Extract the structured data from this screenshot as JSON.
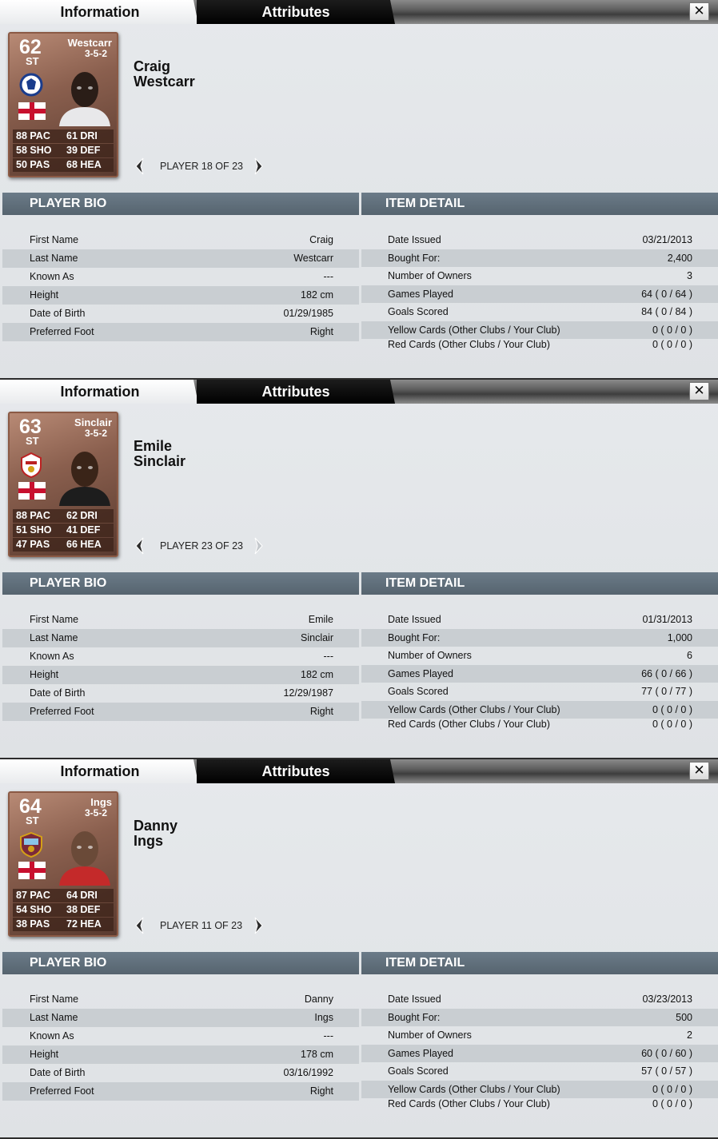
{
  "tabs": {
    "info": "Information",
    "attributes": "Attributes",
    "close": "✕"
  },
  "sections": {
    "bio": "PLAYER BIO",
    "item": "ITEM DETAIL"
  },
  "bio_labels": [
    "First Name",
    "Last Name",
    "Known As",
    "Height",
    "Date of Birth",
    "Preferred Foot"
  ],
  "item_labels": [
    "Date Issued",
    "Bought For:",
    "Number of Owners",
    "Games Played",
    "Goals Scored",
    "Yellow Cards (Other Clubs / Your Club)",
    "Red Cards (Other Clubs / Your Club)"
  ],
  "panels": [
    {
      "card": {
        "overall": "62",
        "position": "ST",
        "name": "Westcarr",
        "formation": "3-5-2",
        "stats": [
          [
            "88 PAC",
            "61 DRI"
          ],
          [
            "58 SHO",
            "39 DEF"
          ],
          [
            "50 PAS",
            "68 HEA"
          ]
        ],
        "club_icon": "chesterfield-badge-icon",
        "nation_icon": "england-flag-icon",
        "photo": "player-photo"
      },
      "first_name": "Craig",
      "last_name": "Westcarr",
      "pager": "PLAYER 18 OF 23",
      "next_enabled": true,
      "bio": [
        "Craig",
        "Westcarr",
        "---",
        "182 cm",
        "01/29/1985",
        "Right"
      ],
      "item": [
        "03/21/2013",
        "2,400",
        "3",
        "64 ( 0 / 64 )",
        "84 ( 0 / 84 )",
        "0 ( 0 / 0 )",
        "0 ( 0 / 0 )"
      ]
    },
    {
      "card": {
        "overall": "63",
        "position": "ST",
        "name": "Sinclair",
        "formation": "3-5-2",
        "stats": [
          [
            "88 PAC",
            "62 DRI"
          ],
          [
            "51 SHO",
            "41 DEF"
          ],
          [
            "47 PAS",
            "66 HEA"
          ]
        ],
        "club_icon": "doncaster-badge-icon",
        "nation_icon": "england-flag-icon",
        "photo": "player-photo"
      },
      "first_name": "Emile",
      "last_name": "Sinclair",
      "pager": "PLAYER 23 OF 23",
      "next_enabled": false,
      "bio": [
        "Emile",
        "Sinclair",
        "---",
        "182 cm",
        "12/29/1987",
        "Right"
      ],
      "item": [
        "01/31/2013",
        "1,000",
        "6",
        "66 ( 0 / 66 )",
        "77 ( 0 / 77 )",
        "0 ( 0 / 0 )",
        "0 ( 0 / 0 )"
      ]
    },
    {
      "card": {
        "overall": "64",
        "position": "ST",
        "name": "Ings",
        "formation": "3-5-2",
        "stats": [
          [
            "87 PAC",
            "64 DRI"
          ],
          [
            "54 SHO",
            "38 DEF"
          ],
          [
            "38 PAS",
            "72 HEA"
          ]
        ],
        "club_icon": "burnley-badge-icon",
        "nation_icon": "england-flag-icon",
        "photo": "player-photo"
      },
      "first_name": "Danny",
      "last_name": "Ings",
      "pager": "PLAYER 11 OF 23",
      "next_enabled": true,
      "bio": [
        "Danny",
        "Ings",
        "---",
        "178 cm",
        "03/16/1992",
        "Right"
      ],
      "item": [
        "03/23/2013",
        "500",
        "2",
        "60 ( 0 / 60 )",
        "57 ( 0 / 57 )",
        "0 ( 0 / 0 )",
        "0 ( 0 / 0 )"
      ]
    }
  ]
}
